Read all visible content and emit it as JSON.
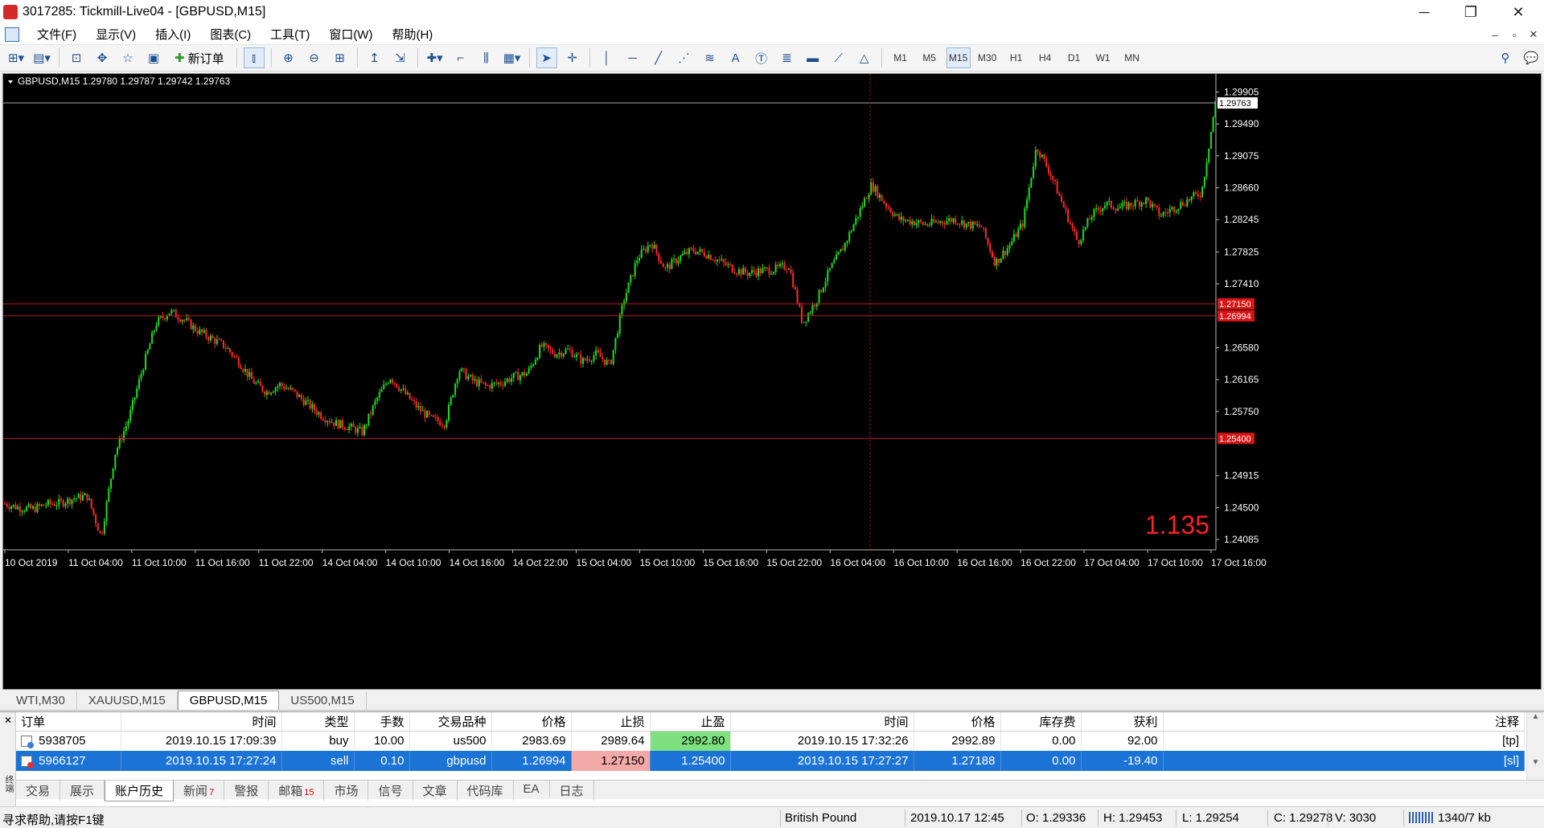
{
  "window": {
    "title": "3017285: Tickmill-Live04 - [GBPUSD,M15]",
    "minimize": "─",
    "restore": "❐",
    "close": "✕"
  },
  "menu": [
    "文件(F)",
    "显示(V)",
    "插入(I)",
    "图表(C)",
    "工具(T)",
    "窗口(W)",
    "帮助(H)"
  ],
  "mdi_controls": [
    "–",
    "▫",
    "✕"
  ],
  "toolbar": {
    "new_order": "新订单",
    "timeframes": [
      "M1",
      "M5",
      "M15",
      "M30",
      "H1",
      "H4",
      "D1",
      "W1",
      "MN"
    ],
    "active_timeframe": "M15"
  },
  "chart": {
    "header": "GBPUSD,M15  1.29780 1.29787 1.29742 1.29763",
    "big_value": "1.135",
    "big_value_color": "#ff2020",
    "current_price": "1.29763",
    "bull_color": "#22dd22",
    "bear_color": "#ff2a2a",
    "hline_color": "#c01818",
    "price_ticks": [
      "1.29905",
      "1.29490",
      "1.29075",
      "1.28660",
      "1.28245",
      "1.27825",
      "1.27410",
      "1.26580",
      "1.26165",
      "1.25750",
      "1.24915",
      "1.24500",
      "1.24085"
    ],
    "marked_levels": [
      "1.27150",
      "1.26994",
      "1.25400"
    ],
    "time_labels": [
      "10 Oct 2019",
      "11 Oct 04:00",
      "11 Oct 10:00",
      "11 Oct 16:00",
      "11 Oct 22:00",
      "14 Oct 04:00",
      "14 Oct 10:00",
      "14 Oct 16:00",
      "14 Oct 22:00",
      "15 Oct 04:00",
      "15 Oct 10:00",
      "15 Oct 16:00",
      "15 Oct 22:00",
      "16 Oct 04:00",
      "16 Oct 10:00",
      "16 Oct 16:00",
      "16 Oct 22:00",
      "17 Oct 04:00",
      "17 Oct 10:00",
      "17 Oct 16:00"
    ]
  },
  "chart_data": {
    "type": "candlestick",
    "symbol": "GBPUSD",
    "timeframe": "M15",
    "ylim": [
      1.2395,
      1.3014
    ],
    "x": [
      "10 Oct 2019",
      "11 Oct 04:00",
      "11 Oct 10:00",
      "11 Oct 16:00",
      "11 Oct 22:00",
      "14 Oct 04:00",
      "14 Oct 10:00",
      "14 Oct 16:00",
      "14 Oct 22:00",
      "15 Oct 04:00",
      "15 Oct 10:00",
      "15 Oct 16:00",
      "15 Oct 22:00",
      "16 Oct 04:00",
      "16 Oct 10:00",
      "16 Oct 16:00",
      "16 Oct 22:00",
      "17 Oct 04:00",
      "17 Oct 10:00",
      "17 Oct 16:00"
    ],
    "close_path": [
      1.2455,
      1.245,
      1.2448,
      1.2454,
      1.2456,
      1.2462,
      1.2465,
      1.2412,
      1.252,
      1.2565,
      1.263,
      1.269,
      1.2705,
      1.2695,
      1.268,
      1.267,
      1.266,
      1.264,
      1.2615,
      1.26,
      1.261,
      1.26,
      1.2585,
      1.257,
      1.256,
      1.2555,
      1.2548,
      1.259,
      1.262,
      1.26,
      1.258,
      1.2565,
      1.256,
      1.263,
      1.2615,
      1.2608,
      1.2612,
      1.262,
      1.2625,
      1.266,
      1.265,
      1.2655,
      1.264,
      1.265,
      1.2635,
      1.272,
      1.2775,
      1.2795,
      1.276,
      1.2775,
      1.2785,
      1.278,
      1.277,
      1.276,
      1.2755,
      1.2758,
      1.276,
      1.2765,
      1.269,
      1.272,
      1.276,
      1.279,
      1.283,
      1.287,
      1.2845,
      1.2825,
      1.2822,
      1.2818,
      1.2822,
      1.2825,
      1.2818,
      1.2815,
      1.2768,
      1.279,
      1.282,
      1.292,
      1.2885,
      1.284,
      1.2795,
      1.283,
      1.2845,
      1.284,
      1.2845,
      1.285,
      1.283,
      1.284,
      1.285,
      1.286,
      1.2976
    ],
    "levels": [
      1.2715,
      1.26994,
      1.254
    ],
    "last_price": 1.29763
  },
  "symbol_tabs": [
    "WTI,M30",
    "XAUUSD,M15",
    "GBPUSD,M15",
    "US500,M15"
  ],
  "active_symbol_tab": "GBPUSD,M15",
  "history": {
    "columns": [
      "订单",
      "时间",
      "类型",
      "手数",
      "交易品种",
      "价格",
      "止损",
      "止盈",
      "时间",
      "价格",
      "库存费",
      "获利",
      "注释"
    ],
    "rows": [
      [
        "5938705",
        "2019.10.15 17:09:39",
        "buy",
        "10.00",
        "us500",
        "2983.69",
        "2989.64",
        "2992.80",
        "2019.10.15 17:32:26",
        "2992.89",
        "0.00",
        "92.00",
        "[tp]"
      ],
      [
        "5966127",
        "2019.10.15 17:27:24",
        "sell",
        "0.10",
        "gbpusd",
        "1.26994",
        "1.27150",
        "1.25400",
        "2019.10.15 17:27:27",
        "1.27188",
        "0.00",
        "-19.40",
        "[sl]"
      ]
    ]
  },
  "terminal": {
    "side_label": "终端",
    "tabs": [
      {
        "label": "交易",
        "count": ""
      },
      {
        "label": "展示",
        "count": ""
      },
      {
        "label": "账户历史",
        "count": ""
      },
      {
        "label": "新闻",
        "count": "7"
      },
      {
        "label": "警报",
        "count": ""
      },
      {
        "label": "邮箱",
        "count": "15"
      },
      {
        "label": "市场",
        "count": ""
      },
      {
        "label": "信号",
        "count": ""
      },
      {
        "label": "文章",
        "count": ""
      },
      {
        "label": "代码库",
        "count": ""
      },
      {
        "label": "EA",
        "count": ""
      },
      {
        "label": "日志",
        "count": ""
      }
    ],
    "active_tab": "账户历史"
  },
  "status": {
    "help": "寻求帮助,请按F1键",
    "symbol_desc": "British Pound",
    "datetime": "2019.10.17 12:45",
    "open": "O: 1.29336",
    "high": "H: 1.29453",
    "low": "L: 1.29254",
    "close": "C: 1.29278",
    "volume": "V: 3030",
    "traffic": "1340/7 kb"
  }
}
